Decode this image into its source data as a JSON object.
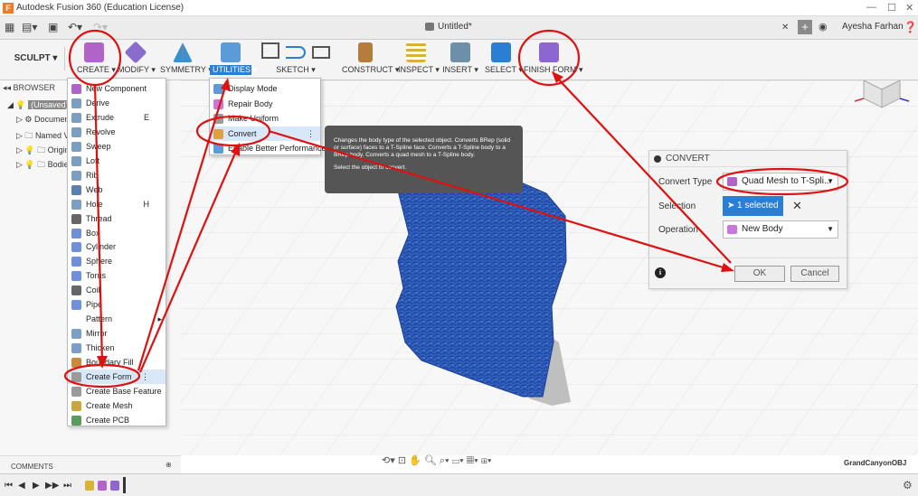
{
  "window": {
    "title": "Autodesk Fusion 360 (Education License)",
    "document_title": "Untitled*",
    "user": "Ayesha Farhan"
  },
  "toolbar": {
    "mode": "SCULPT",
    "tools": [
      {
        "label": "CREATE",
        "color": "#b163c8"
      },
      {
        "label": "MODIFY",
        "color": "#8a6ccd"
      },
      {
        "label": "SYMMETRY",
        "color": "#3a8fd0"
      },
      {
        "label": "UTILITIES",
        "color": "#5a9bd8"
      },
      {
        "label": "SKETCH",
        "color": "#5a80b0"
      },
      {
        "label": "CONSTRUCT",
        "color": "#b57c3e"
      },
      {
        "label": "INSPECT",
        "color": "#d6b23a"
      },
      {
        "label": "INSERT",
        "color": "#6e8fa8"
      },
      {
        "label": "SELECT",
        "color": "#2a7fd4"
      },
      {
        "label": "FINISH FORM",
        "color": "#8e66cf"
      }
    ]
  },
  "browser": {
    "header": "BROWSER",
    "items": [
      "(Unsaved)",
      "Document Settings",
      "Named Views",
      "Origin",
      "Bodies"
    ]
  },
  "create_menu": {
    "items": [
      {
        "label": "New Component",
        "shortcut": ""
      },
      {
        "label": "Derive",
        "shortcut": ""
      },
      {
        "label": "Extrude",
        "shortcut": "E"
      },
      {
        "label": "Revolve",
        "shortcut": ""
      },
      {
        "label": "Sweep",
        "shortcut": ""
      },
      {
        "label": "Loft",
        "shortcut": ""
      },
      {
        "label": "Rib",
        "shortcut": ""
      },
      {
        "label": "Web",
        "shortcut": ""
      },
      {
        "label": "Hole",
        "shortcut": "H"
      },
      {
        "label": "Thread",
        "shortcut": ""
      },
      {
        "label": "Box",
        "shortcut": ""
      },
      {
        "label": "Cylinder",
        "shortcut": ""
      },
      {
        "label": "Sphere",
        "shortcut": ""
      },
      {
        "label": "Torus",
        "shortcut": ""
      },
      {
        "label": "Coil",
        "shortcut": ""
      },
      {
        "label": "Pipe",
        "shortcut": ""
      },
      {
        "label": "Pattern",
        "shortcut": "▸"
      },
      {
        "label": "Mirror",
        "shortcut": ""
      },
      {
        "label": "Thicken",
        "shortcut": ""
      },
      {
        "label": "Boundary Fill",
        "shortcut": ""
      },
      {
        "label": "Create Form",
        "shortcut": "⋮"
      },
      {
        "label": "Create Base Feature",
        "shortcut": ""
      },
      {
        "label": "Create Mesh",
        "shortcut": ""
      },
      {
        "label": "Create PCB",
        "shortcut": ""
      }
    ]
  },
  "utilities_menu": {
    "items": [
      {
        "label": "Display Mode"
      },
      {
        "label": "Repair Body"
      },
      {
        "label": "Make Uniform"
      },
      {
        "label": "Convert"
      },
      {
        "label": "Enable Better Performance"
      }
    ]
  },
  "tooltip": {
    "line1": "Changes the body type of the selected object. Converts BRep (solid or surface) faces to a T-Spline face. Converts a T-Spline body to a BRep body. Converts a quad mesh to a T-Spline body.",
    "line2": "Select the object to convert."
  },
  "dialog": {
    "title": "CONVERT",
    "convert_type_label": "Convert Type",
    "convert_type_value": "Quad Mesh to T-Spli...",
    "selection_label": "Selection",
    "selection_value": "1 selected",
    "operation_label": "Operation",
    "operation_value": "New Body",
    "ok": "OK",
    "cancel": "Cancel"
  },
  "bottom": {
    "comments": "COMMENTS",
    "filename": "GrandCanyonOBJ"
  },
  "colors": {
    "mesh_blue": "#2f5fbf",
    "annotation_red": "#e01010",
    "accent_blue": "#2a7fd4"
  }
}
